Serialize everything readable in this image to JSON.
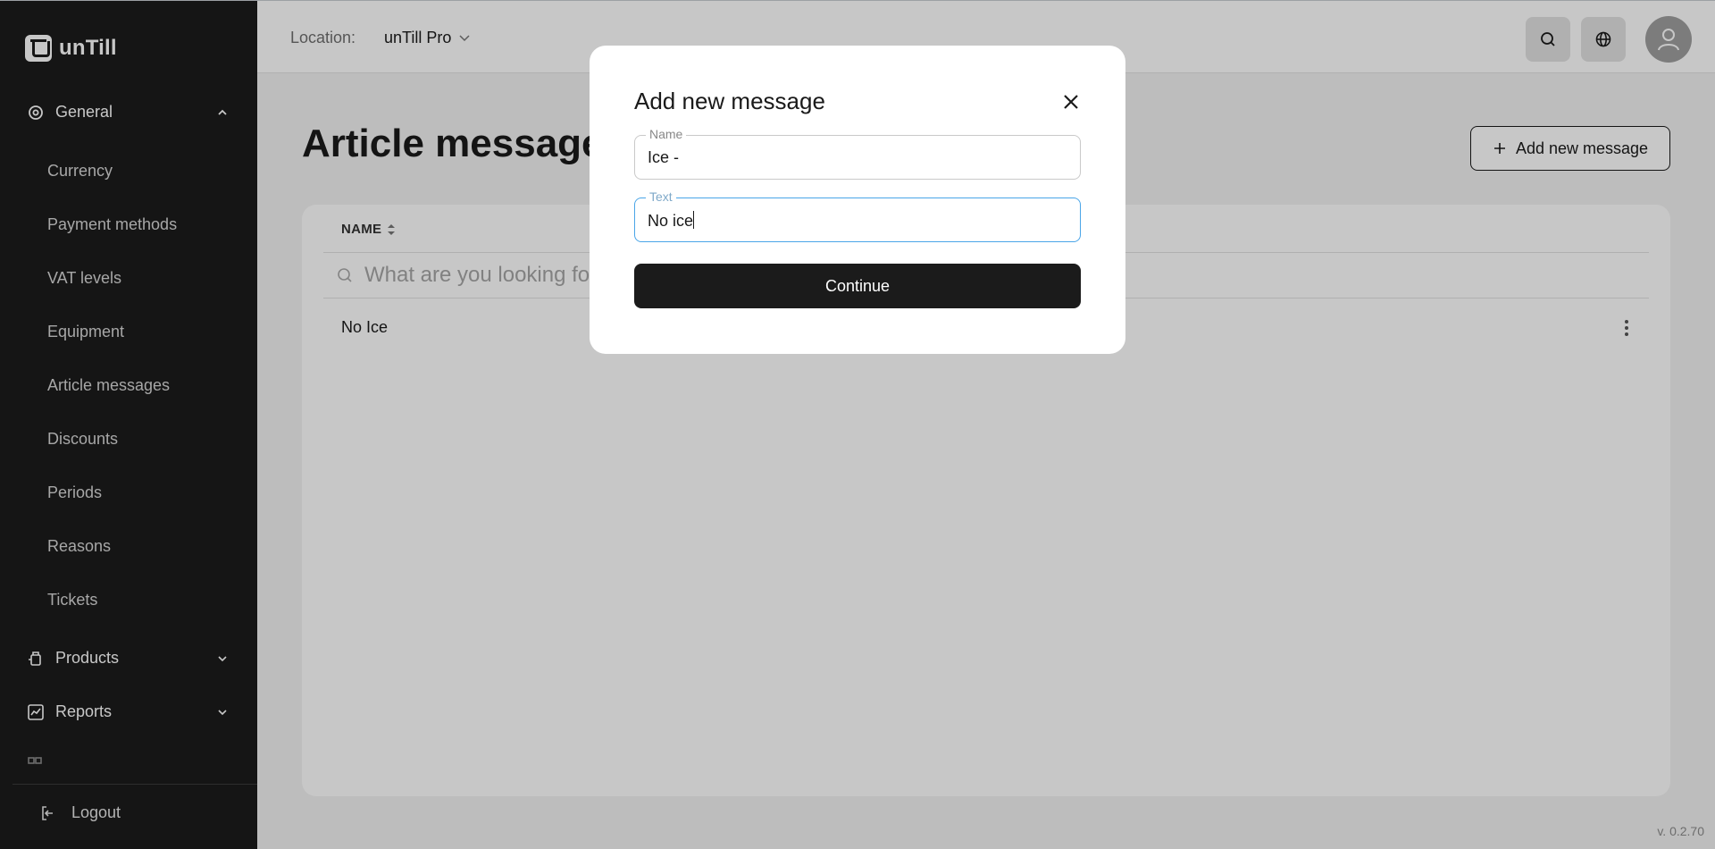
{
  "app": {
    "logo_text": "unTill"
  },
  "sidebar": {
    "general_label": "General",
    "general_items": [
      {
        "label": "Currency"
      },
      {
        "label": "Payment methods"
      },
      {
        "label": "VAT levels"
      },
      {
        "label": "Equipment"
      },
      {
        "label": "Article messages"
      },
      {
        "label": "Discounts"
      },
      {
        "label": "Periods"
      },
      {
        "label": "Reasons"
      },
      {
        "label": "Tickets"
      }
    ],
    "products_label": "Products",
    "reports_label": "Reports",
    "logout_label": "Logout"
  },
  "topbar": {
    "location_label": "Location:",
    "location_value": "unTill Pro"
  },
  "page": {
    "title": "Article messages",
    "add_button_label": "Add new message",
    "column_name": "NAME",
    "search_placeholder": "What are you looking for?",
    "rows": [
      {
        "name": "No Ice"
      }
    ],
    "version": "v. 0.2.70"
  },
  "modal": {
    "title": "Add new message",
    "name_label": "Name",
    "name_value": "Ice -",
    "text_label": "Text",
    "text_value": "No ice",
    "continue_label": "Continue"
  }
}
